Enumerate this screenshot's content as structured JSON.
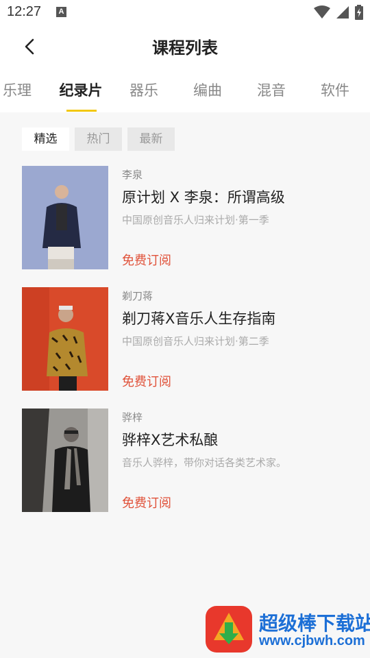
{
  "status_bar": {
    "time": "12:27",
    "notification_letter": "A",
    "icons": [
      "wifi-icon",
      "cell-signal-icon",
      "battery-charging-icon"
    ]
  },
  "header": {
    "title": "课程列表",
    "back_icon": "chevron-left-icon"
  },
  "tabs": [
    {
      "label": "乐理",
      "active": false
    },
    {
      "label": "纪录片",
      "active": true
    },
    {
      "label": "器乐",
      "active": false
    },
    {
      "label": "编曲",
      "active": false
    },
    {
      "label": "混音",
      "active": false
    },
    {
      "label": "软件",
      "active": false
    }
  ],
  "filters": [
    {
      "label": "精选",
      "active": true
    },
    {
      "label": "热门",
      "active": false
    },
    {
      "label": "最新",
      "active": false
    }
  ],
  "courses": [
    {
      "author": "李泉",
      "title": "原计划 X 李泉：所谓高级",
      "description": "中国原创音乐人归来计划·第一季",
      "subscribe_label": "免费订阅"
    },
    {
      "author": "剃刀蒋",
      "title": "剃刀蒋X音乐人生存指南",
      "description": "中国原创音乐人归来计划·第二季",
      "subscribe_label": "免费订阅"
    },
    {
      "author": "骅梓",
      "title": "骅梓X艺术私酿",
      "description": "音乐人骅梓，带你对话各类艺术家。",
      "subscribe_label": "免费订阅"
    }
  ],
  "colors": {
    "accent_indicator": "#f2c811",
    "subscribe": "#e0523a",
    "watermark_blue": "#1c6fd6"
  },
  "watermark": {
    "name": "超级棒下载站",
    "url": "www.cjbwh.com"
  }
}
